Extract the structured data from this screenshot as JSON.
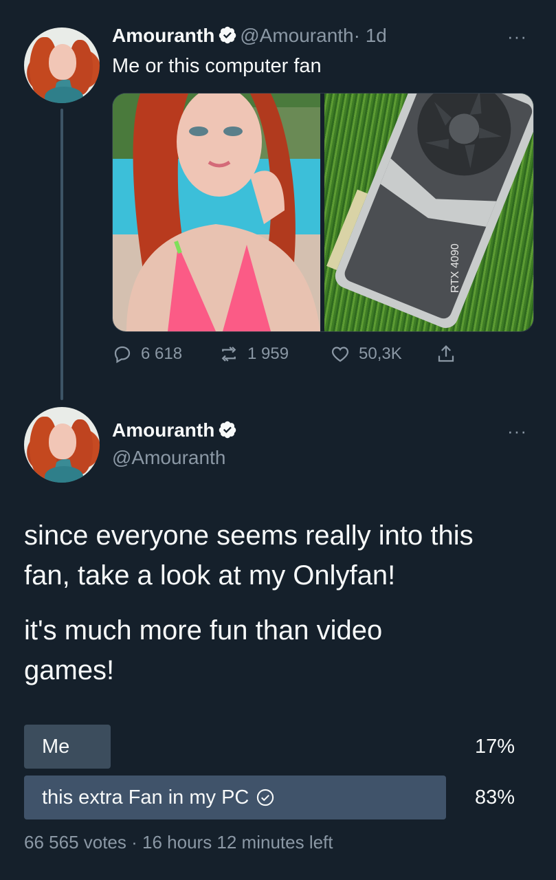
{
  "tweet1": {
    "name": "Amouranth",
    "handle": "@Amouranth",
    "time": "· 1d",
    "text": "Me or this computer fan",
    "more": "···",
    "images": [
      "woman-in-pink-bikini",
      "graphics-card-on-grass"
    ],
    "gpu_label": "RTX 4090",
    "stats": {
      "replies": "6 618",
      "retweets": "1 959",
      "likes": "50,3K"
    }
  },
  "tweet2": {
    "name": "Amouranth",
    "handle": "@Amouranth",
    "more": "···",
    "paragraph1_line1": "since everyone seems really into this",
    "paragraph1_line2": "fan, take a look at my Onlyfan!",
    "paragraph2_line1": "it's much more fun than video",
    "paragraph2_line2": "games!",
    "poll": {
      "options": [
        {
          "label": "Me",
          "percent": "17%",
          "fraction": 0.17,
          "voted": false
        },
        {
          "label": "this extra Fan in my PC",
          "percent": "83%",
          "fraction": 0.83,
          "voted": true
        }
      ],
      "votes": "66 565 votes",
      "time_left": "· 16 hours 12 minutes left"
    }
  },
  "colors": {
    "background": "#15202b",
    "secondary_text": "#8b98a5",
    "verified_blue": "#f7f9f9",
    "poll_bar": "#3c4d5d"
  }
}
